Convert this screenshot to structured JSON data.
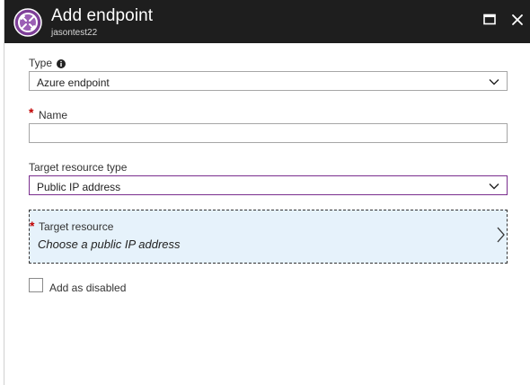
{
  "header": {
    "title": "Add endpoint",
    "subtitle": "jasontest22",
    "icon": "traffic-manager-icon",
    "maximize_icon": "maximize-icon",
    "close_icon": "close-icon"
  },
  "form": {
    "type": {
      "label": "Type",
      "value": "Azure endpoint"
    },
    "name": {
      "label": "Name",
      "required_mark": "*",
      "value": "",
      "placeholder": ""
    },
    "target_resource_type": {
      "label": "Target resource type",
      "value": "Public IP address"
    },
    "target_resource": {
      "label": "Target resource",
      "required_mark": "*",
      "value": "Choose a public IP address"
    },
    "disabled_checkbox": {
      "label": "Add as disabled",
      "checked": false
    }
  },
  "colors": {
    "header_bg": "#1e1e1e",
    "focus_border": "#7a2e8e",
    "picker_bg": "#e6f2fb",
    "required": "#c00000",
    "icon_purple": "#7e3f98"
  }
}
